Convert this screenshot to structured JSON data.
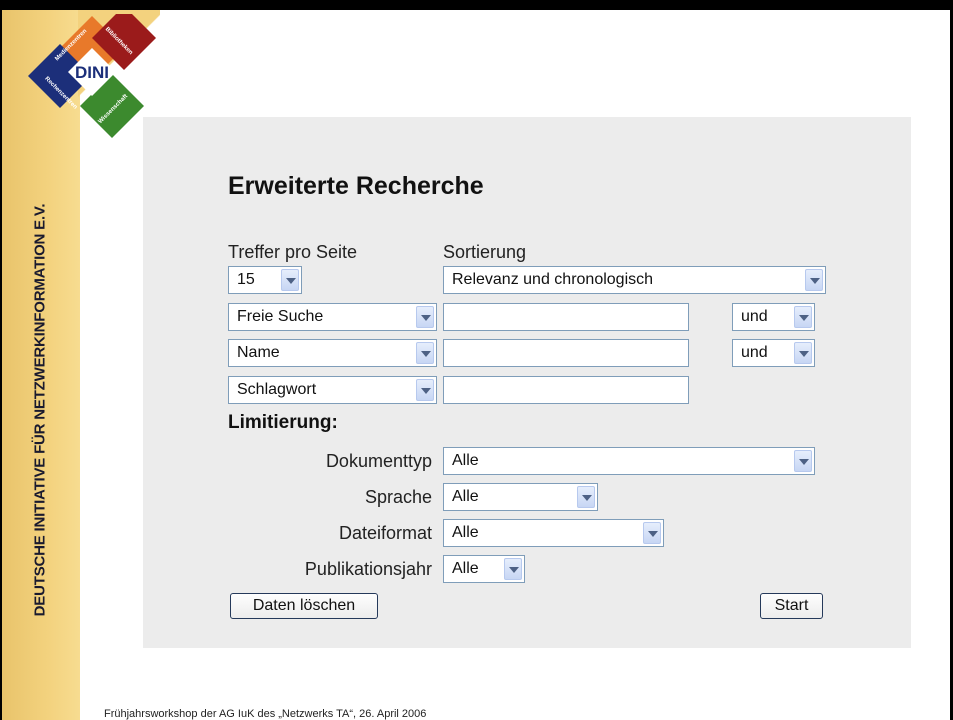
{
  "sidebar": {
    "vertical_title": "DEUTSCHE INITIATIVE FÜR NETZWERKINFORMATION E.V."
  },
  "logo": {
    "center": "DINI",
    "top_left": "Medienzentren",
    "top_right": "Bibliotheken",
    "bottom_left": "Rechenzentren",
    "bottom_right": "Wissenschaft",
    "colors": {
      "orange": "#e8792a",
      "red": "#9b1b1b",
      "blue": "#1c2f7a",
      "green": "#3c8a2e"
    }
  },
  "form": {
    "title": "Erweiterte Recherche",
    "treffer_label": "Treffer pro Seite",
    "treffer_value": "15",
    "sortierung_label": "Sortierung",
    "sortierung_value": "Relevanz und chronologisch",
    "rows": [
      {
        "field": "Freie Suche",
        "value": "",
        "operator": "und"
      },
      {
        "field": "Name",
        "value": "",
        "operator": "und"
      },
      {
        "field": "Schlagwort",
        "value": ""
      }
    ],
    "limitierung_label": "Limitierung:",
    "limits": {
      "dokumenttyp": {
        "label": "Dokumenttyp",
        "value": "Alle"
      },
      "sprache": {
        "label": "Sprache",
        "value": "Alle"
      },
      "dateiformat": {
        "label": "Dateiformat",
        "value": "Alle"
      },
      "publikationsjahr": {
        "label": "Publikationsjahr",
        "value": "Alle"
      }
    },
    "clear_button": "Daten löschen",
    "start_button": "Start"
  },
  "footer": "Frühjahrsworkshop der AG IuK des „Netzwerks TA“, 26. April 2006"
}
